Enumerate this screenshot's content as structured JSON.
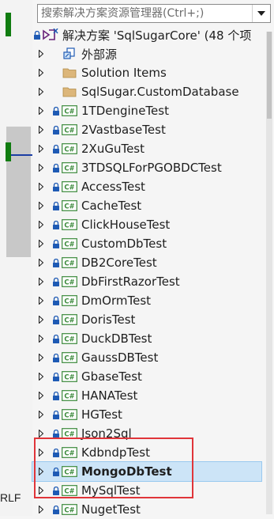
{
  "editor": {
    "line_ending": "RLF"
  },
  "search": {
    "placeholder": "搜索解决方案资源管理器(Ctrl+;)"
  },
  "tree": {
    "solution": {
      "label": "解决方案 'SqlSugarCore' (48 个项"
    },
    "items": [
      {
        "label": "外部源",
        "icon": "external-source-icon",
        "level": 1,
        "lock": false,
        "selected": false
      },
      {
        "label": "Solution Items",
        "icon": "folder-icon",
        "level": 1,
        "lock": false,
        "selected": false
      },
      {
        "label": "SqlSugar.CustomDatabase",
        "icon": "folder-icon",
        "level": 1,
        "lock": false,
        "selected": false
      },
      {
        "label": "1TDengineTest",
        "icon": "csharp-project-icon",
        "level": 1,
        "lock": true,
        "selected": false
      },
      {
        "label": "2VastbaseTest",
        "icon": "csharp-project-icon",
        "level": 1,
        "lock": true,
        "selected": false
      },
      {
        "label": "2XuGuTest",
        "icon": "csharp-project-icon",
        "level": 1,
        "lock": true,
        "selected": false
      },
      {
        "label": "3TDSQLForPGOBDCTest",
        "icon": "csharp-project-icon",
        "level": 1,
        "lock": true,
        "selected": false
      },
      {
        "label": "AccessTest",
        "icon": "csharp-project-icon",
        "level": 1,
        "lock": true,
        "selected": false
      },
      {
        "label": "CacheTest",
        "icon": "csharp-project-icon",
        "level": 1,
        "lock": true,
        "selected": false
      },
      {
        "label": "ClickHouseTest",
        "icon": "csharp-project-icon",
        "level": 1,
        "lock": true,
        "selected": false
      },
      {
        "label": "CustomDbTest",
        "icon": "csharp-project-icon",
        "level": 1,
        "lock": true,
        "selected": false
      },
      {
        "label": "DB2CoreTest",
        "icon": "csharp-project-icon",
        "level": 1,
        "lock": true,
        "selected": false
      },
      {
        "label": "DbFirstRazorTest",
        "icon": "csharp-project-icon",
        "level": 1,
        "lock": true,
        "selected": false
      },
      {
        "label": "DmOrmTest",
        "icon": "csharp-project-icon",
        "level": 1,
        "lock": true,
        "selected": false
      },
      {
        "label": "DorisTest",
        "icon": "csharp-project-icon",
        "level": 1,
        "lock": true,
        "selected": false
      },
      {
        "label": "DuckDBTest",
        "icon": "csharp-project-icon",
        "level": 1,
        "lock": true,
        "selected": false
      },
      {
        "label": "GaussDBTest",
        "icon": "csharp-project-icon",
        "level": 1,
        "lock": true,
        "selected": false
      },
      {
        "label": "GbaseTest",
        "icon": "csharp-project-icon",
        "level": 1,
        "lock": true,
        "selected": false
      },
      {
        "label": "HANATest",
        "icon": "csharp-project-icon",
        "level": 1,
        "lock": true,
        "selected": false
      },
      {
        "label": "HGTest",
        "icon": "csharp-project-icon",
        "level": 1,
        "lock": true,
        "selected": false
      },
      {
        "label": "Json2Sql",
        "icon": "csharp-project-icon",
        "level": 1,
        "lock": true,
        "selected": false
      },
      {
        "label": "KdbndpTest",
        "icon": "csharp-project-icon",
        "level": 1,
        "lock": true,
        "selected": false
      },
      {
        "label": "MongoDbTest",
        "icon": "csharp-project-icon",
        "level": 1,
        "lock": true,
        "selected": true
      },
      {
        "label": "MySqlTest",
        "icon": "csharp-project-icon",
        "level": 1,
        "lock": true,
        "selected": false
      },
      {
        "label": "NugetTest",
        "icon": "csharp-project-icon",
        "level": 1,
        "lock": true,
        "selected": false
      }
    ]
  },
  "colors": {
    "selection": "#cce4f7",
    "highlight": "#e0353a",
    "csharp": "#3c8a3c"
  }
}
